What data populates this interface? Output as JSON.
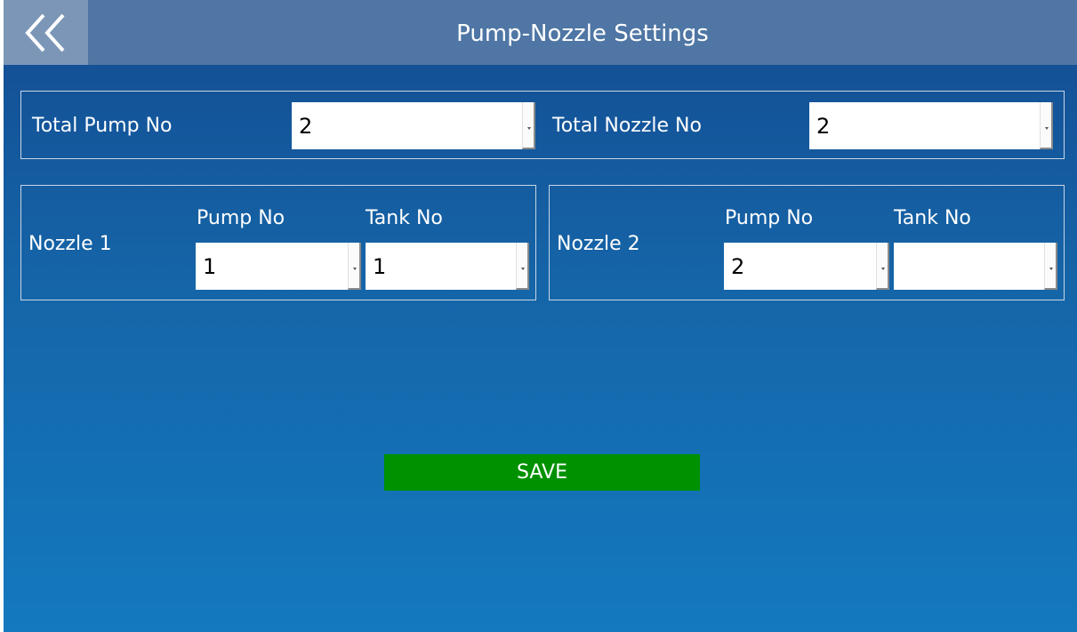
{
  "header": {
    "title": "Pump-Nozzle Settings",
    "back_icon": "double-chevron-left-icon"
  },
  "totals": {
    "pump_label": "Total Pump No",
    "pump_value": "2",
    "nozzle_label": "Total Nozzle No",
    "nozzle_value": "2"
  },
  "nozzles": [
    {
      "name": "Nozzle 1",
      "pump_label": "Pump No",
      "tank_label": "Tank No",
      "pump_value": "1",
      "tank_value": "1"
    },
    {
      "name": "Nozzle 2",
      "pump_label": "Pump No",
      "tank_label": "Tank No",
      "pump_value": "2",
      "tank_value": ""
    }
  ],
  "actions": {
    "save_label": "SAVE"
  },
  "colors": {
    "header_bg": "#4f76a4",
    "back_button_bg": "#7b96b6",
    "save_button_bg": "#009100",
    "background_top": "#144b91",
    "background_bottom": "#1479bf"
  }
}
